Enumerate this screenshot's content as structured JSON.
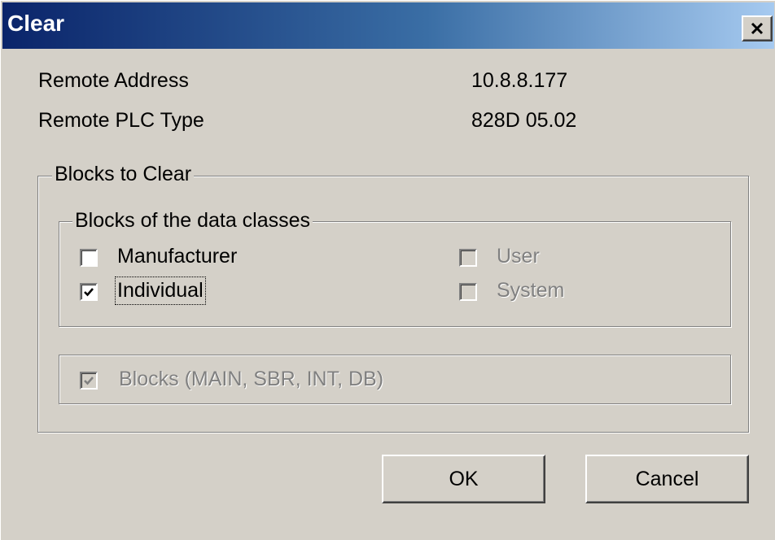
{
  "window": {
    "title": "Clear",
    "close_glyph": "×"
  },
  "info": {
    "remote_address_label": "Remote Address",
    "remote_address_value": "10.8.8.177",
    "remote_plc_type_label": "Remote PLC Type",
    "remote_plc_type_value": "828D 05.02"
  },
  "blocks_to_clear": {
    "legend": "Blocks to Clear",
    "data_classes": {
      "legend": "Blocks of the data classes",
      "options": [
        {
          "label": "Manufacturer",
          "checked": false,
          "enabled": true
        },
        {
          "label": "Individual",
          "checked": true,
          "enabled": true,
          "focused": true
        },
        {
          "label": "User",
          "checked": false,
          "enabled": false
        },
        {
          "label": "System",
          "checked": false,
          "enabled": false
        }
      ]
    },
    "blocks_option": {
      "label": "Blocks (MAIN, SBR, INT, DB)",
      "checked": true,
      "enabled": false
    }
  },
  "buttons": {
    "ok": "OK",
    "cancel": "Cancel"
  },
  "colors": {
    "face": "#d4d0c8",
    "title_start": "#0a246a",
    "title_end": "#a6caf0",
    "disabled_text": "#808080"
  },
  "icons": {
    "close": "close-icon",
    "check": "checkmark-icon"
  }
}
